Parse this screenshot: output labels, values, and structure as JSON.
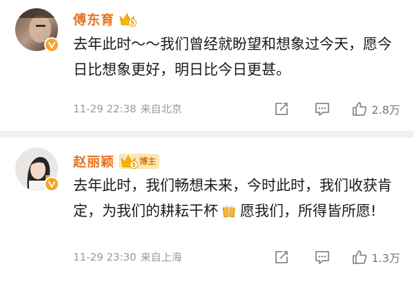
{
  "comments": [
    {
      "username": "傅东育",
      "crown_level": "5",
      "text": "去年此时～～我们曾经就盼望和想象过今天，愿今日比想象更好，明日比今日更甚。",
      "time": "11-29 22:38",
      "location": "来自北京",
      "likes": "2.8万"
    },
    {
      "username": "赵丽颖",
      "crown_level": "5",
      "tag": "博主",
      "text_before_emoji": "去年此时，我们畅想未来，今时此时，我们收获肯定，为我们的耕耘干杯",
      "text_after_emoji": "愿我们，所得皆所愿!",
      "time": "11-29 23:30",
      "location": "来自上海",
      "likes": "1.3万"
    }
  ],
  "icons": {
    "share": "share-icon",
    "comment": "comment-icon",
    "like": "thumbs-up-icon",
    "verified": "verified-v-icon",
    "cheers": "beer-cheers-emoji"
  },
  "colors": {
    "username": "#e8711f",
    "meta": "#999999",
    "separator": "#f1f1f1",
    "verified_badge": "#f5a623"
  }
}
